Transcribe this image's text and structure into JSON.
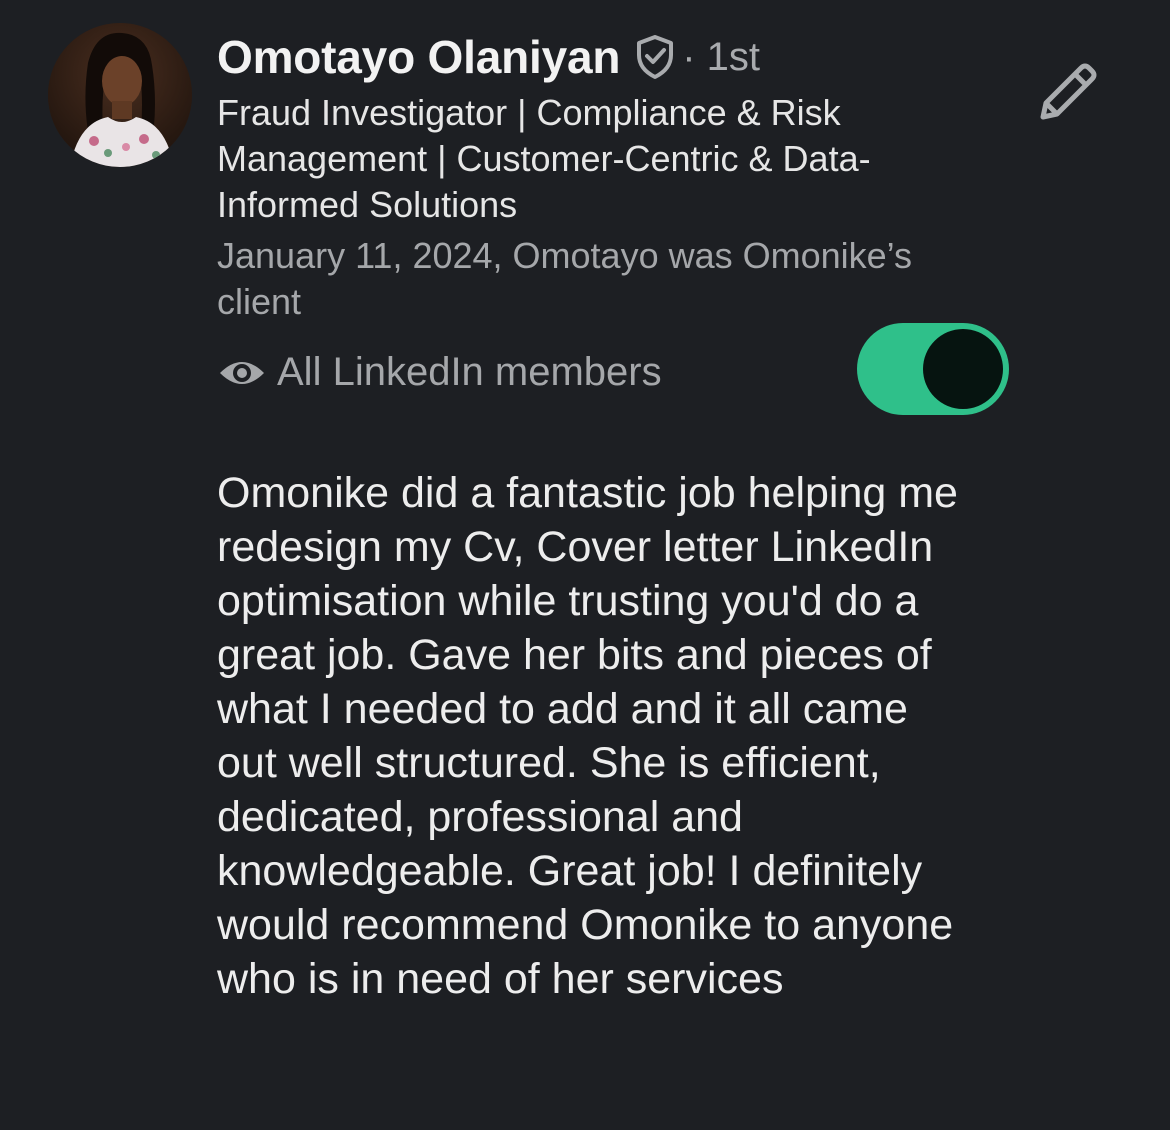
{
  "recommendation": {
    "author_name": "Omotayo Olaniyan",
    "verified_icon": "verified-shield-icon",
    "connection_degree": "· 1st",
    "headline": "Fraud Investigator | Compliance & Risk Management | Customer-Centric & Data-Informed Solutions",
    "relationship": "January 11, 2024, Omotayo was Omonike’s client",
    "visibility_icon": "eye-icon",
    "visibility_label": "All LinkedIn members",
    "visibility_toggle_on": true,
    "edit_icon": "pencil-icon",
    "text": "Omonike did a fantastic job helping me redesign my Cv, Cover letter LinkedIn optimisation while trusting you'd do a great job. Gave her bits and pieces of what I needed to add and it all came out well structured.  She is efficient, dedicated, professional and knowledgeable.  Great job! I definitely would recommend Omonike to anyone who is in need of her services"
  },
  "colors": {
    "background": "#1d1f23",
    "toggle_on": "#2fc08a",
    "primary_text": "#f2f2f2",
    "secondary_text": "#a5a7aa"
  }
}
